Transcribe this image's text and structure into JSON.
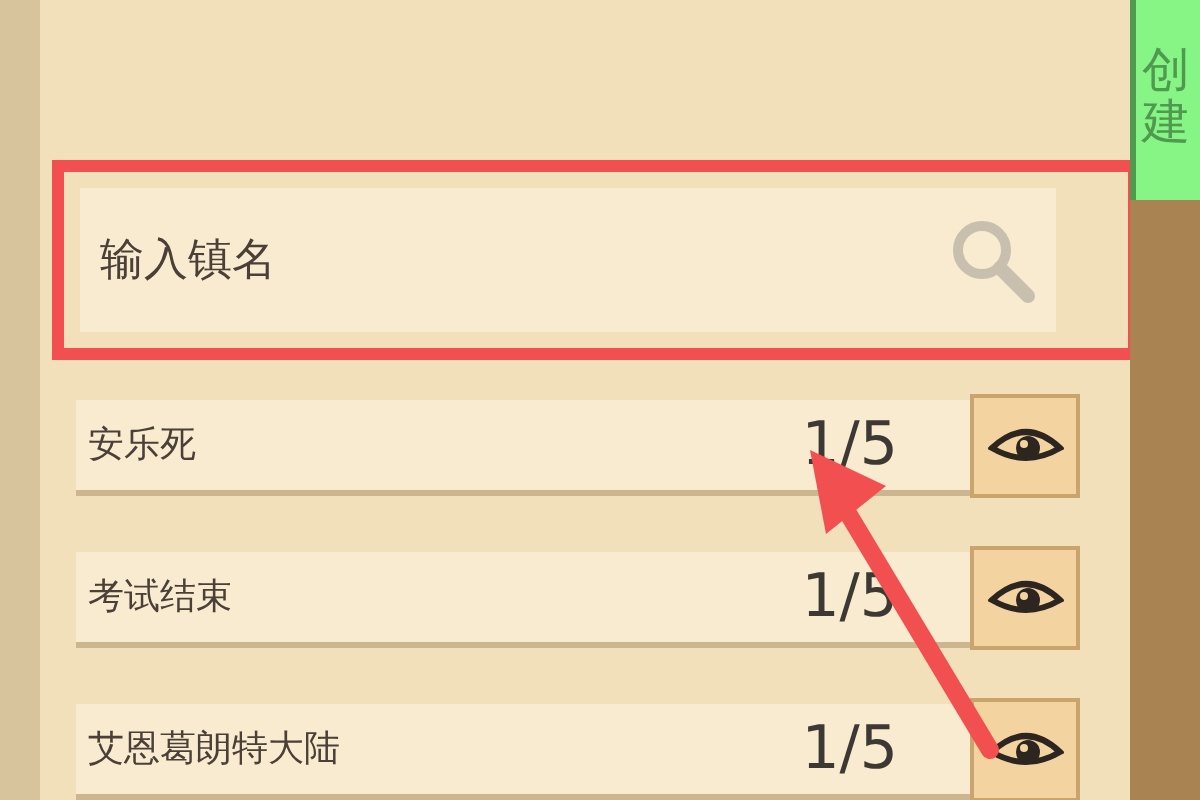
{
  "side_tab": {
    "label": "创建"
  },
  "search": {
    "placeholder": "输入镇名"
  },
  "towns": [
    {
      "name": "安乐死",
      "count": "1/5"
    },
    {
      "name": "考试结束",
      "count": "1/5"
    },
    {
      "name": "艾恩葛朗特大陆",
      "count": "1/5"
    }
  ]
}
